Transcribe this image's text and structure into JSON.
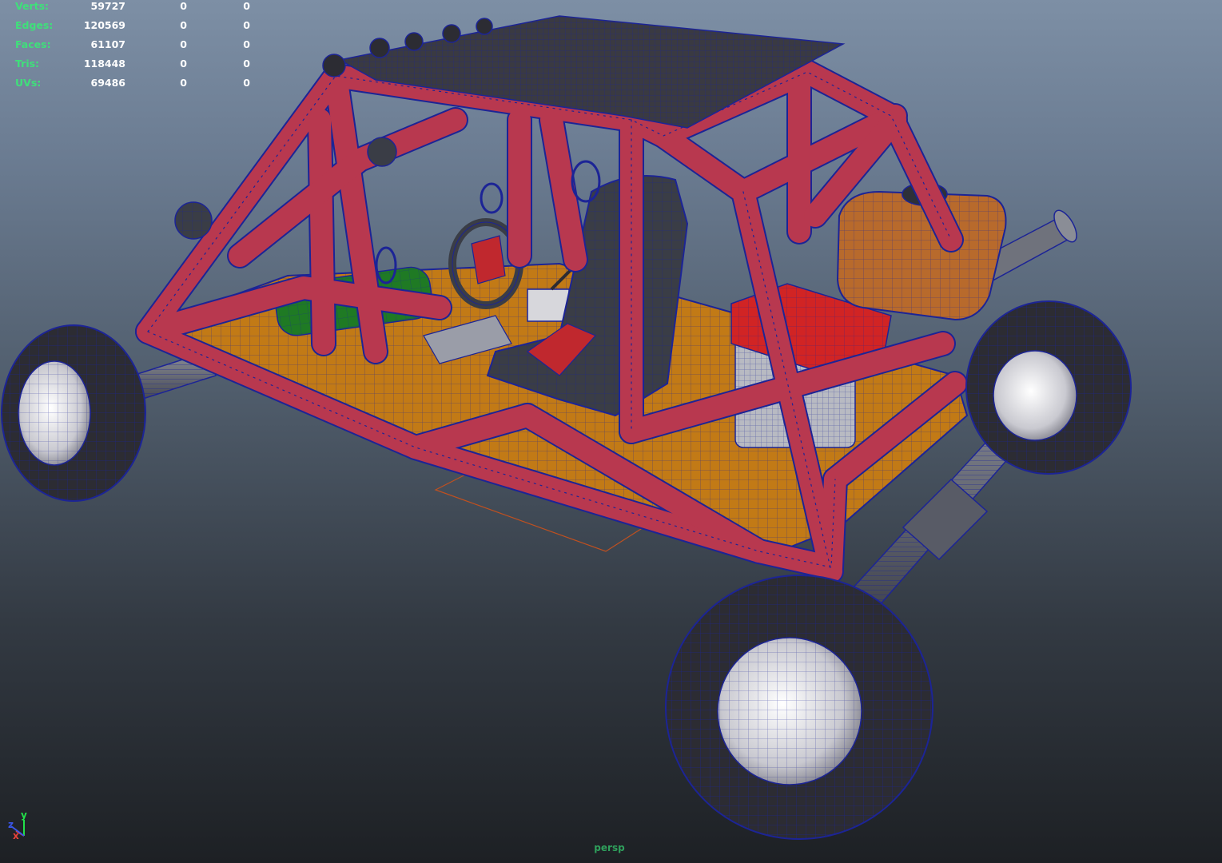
{
  "hud": {
    "rows": [
      {
        "label": "Verts:",
        "v1": "59727",
        "v2": "0",
        "v3": "0"
      },
      {
        "label": "Edges:",
        "v1": "120569",
        "v2": "0",
        "v3": "0"
      },
      {
        "label": "Faces:",
        "v1": "61107",
        "v2": "0",
        "v3": "0"
      },
      {
        "label": "Tris:",
        "v1": "118448",
        "v2": "0",
        "v3": "0"
      },
      {
        "label": "UVs:",
        "v1": "69486",
        "v2": "0",
        "v3": "0"
      }
    ]
  },
  "camera": {
    "label": "persp"
  },
  "axis": {
    "y": "y",
    "x": "x",
    "z": "z"
  },
  "colors": {
    "frame": "#b8384f",
    "wire": "#1c2496",
    "floor": "#c27a16",
    "tire": "#2c2c33",
    "tank": "#b86a2c",
    "engine": "#d12424",
    "battery": "#1f7a24",
    "axis_y": "#22e04a",
    "axis_x": "#e8423a",
    "axis_z": "#3a56e8"
  }
}
